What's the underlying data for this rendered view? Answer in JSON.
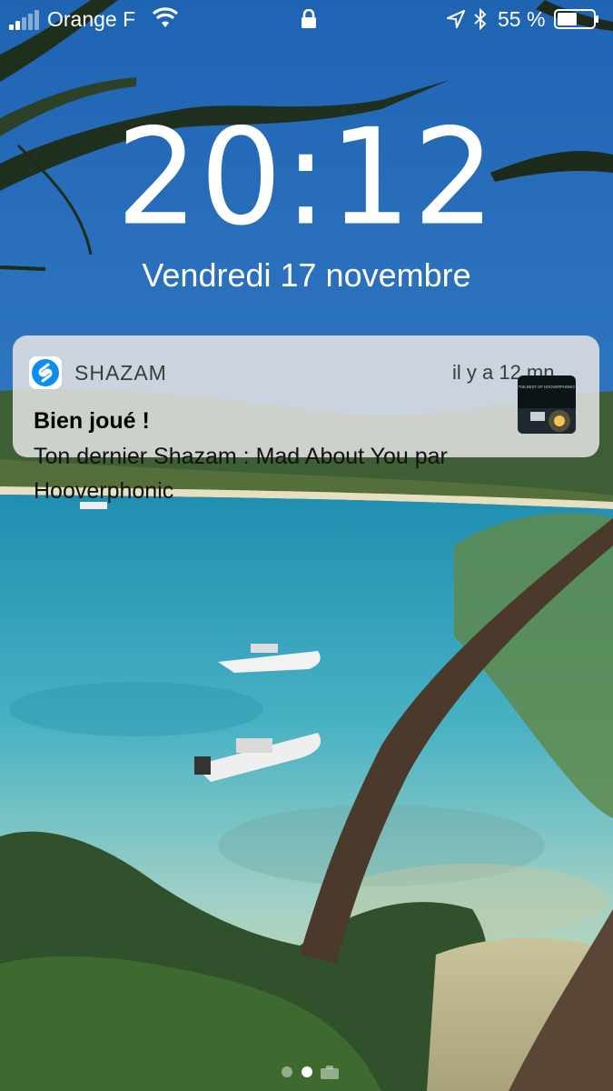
{
  "status_bar": {
    "carrier": "Orange F",
    "battery_percent": "55 %",
    "battery_level": 0.55,
    "icons": [
      "signal-icon",
      "wifi-icon",
      "lock-icon",
      "location-arrow-icon",
      "bluetooth-icon",
      "battery-icon"
    ]
  },
  "lock_screen": {
    "time": "20:12",
    "date": "Vendredi 17 novembre"
  },
  "notification": {
    "app_name": "SHAZAM",
    "time_ago": "il y a 12 mn",
    "title": "Bien joué !",
    "body": "Ton dernier Shazam : Mad About You par Hooverphonic",
    "album_art_text": "THE BEST OF HOOVERPHONIC",
    "icon": "shazam-icon"
  },
  "page_indicator": {
    "pages": 3,
    "active_index": 1
  },
  "colors": {
    "sky": "#2f7ac4",
    "sea": "#3aa9bd",
    "notification_bg": "#e1e1e1",
    "shazam_blue": "#0b8ef0"
  }
}
